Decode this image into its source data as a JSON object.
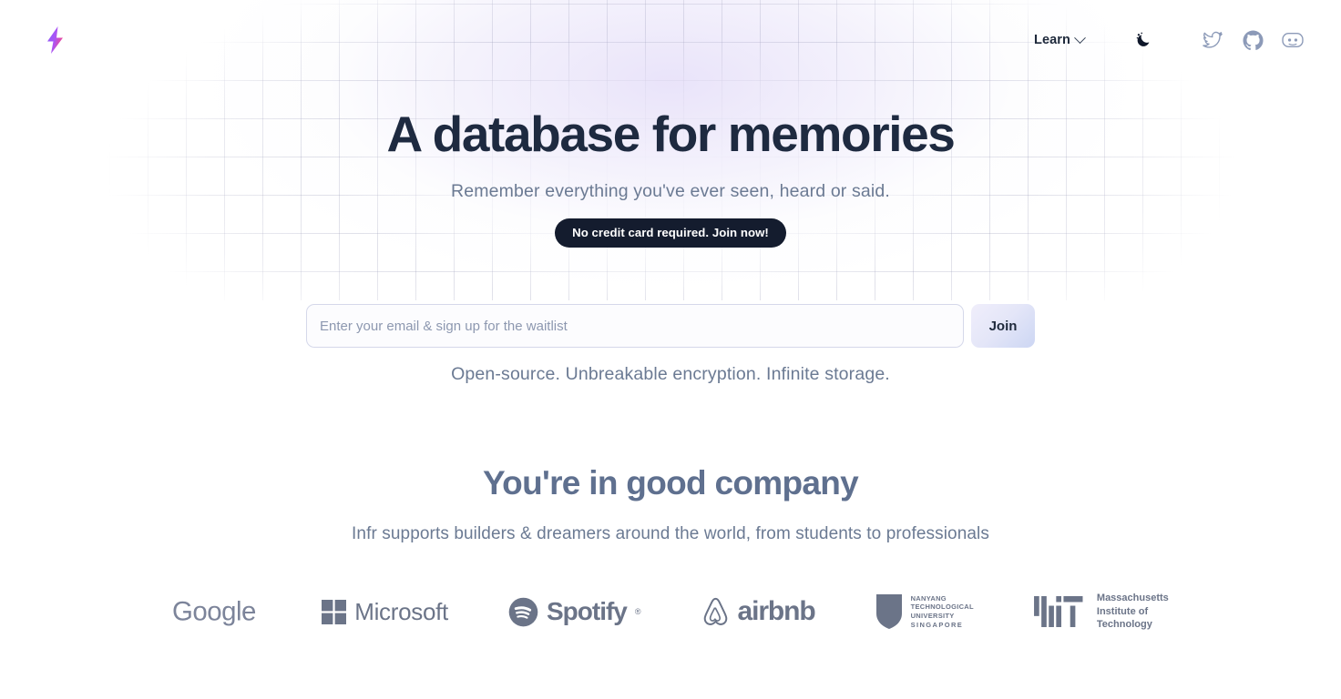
{
  "brand": {
    "logo_icon": "lightning-bolt-icon",
    "logo_gradient_from": "#7c3aed",
    "logo_gradient_to": "#e8379f"
  },
  "nav": {
    "learn_label": "Learn",
    "learn_chevron_icon": "chevron-down-icon",
    "theme_toggle_icon": "moon-stars-icon",
    "socials": [
      {
        "name": "twitter-icon",
        "label": "Twitter"
      },
      {
        "name": "github-icon",
        "label": "GitHub"
      },
      {
        "name": "discord-icon",
        "label": "Discord"
      }
    ]
  },
  "hero": {
    "headline": "A database for memories",
    "subhead": "Remember everything you've ever seen, heard or said.",
    "badge": "No credit card required. Join now!"
  },
  "signup": {
    "placeholder": "Enter your email & sign up for the waitlist",
    "value": "",
    "join_label": "Join"
  },
  "tagline": "Open-source. Unbreakable encryption. Infinite storage.",
  "company": {
    "title": "You're in good company",
    "subtitle": "Infr supports builders & dreamers around the world, from students to professionals",
    "logos": [
      {
        "name": "google-logo",
        "label": "Google"
      },
      {
        "name": "microsoft-logo",
        "label": "Microsoft"
      },
      {
        "name": "spotify-logo",
        "label": "Spotify"
      },
      {
        "name": "airbnb-logo",
        "label": "airbnb"
      },
      {
        "name": "ntu-logo",
        "line1": "NANYANG",
        "line2": "TECHNOLOGICAL",
        "line3": "UNIVERSITY",
        "line4": "SINGAPORE"
      },
      {
        "name": "mit-logo",
        "line1": "Massachusetts",
        "line2": "Institute of",
        "line3": "Technology"
      }
    ]
  },
  "colors": {
    "text_dark": "#1e2a40",
    "text_muted": "#6b7a93",
    "logo_gray": "#6b7488",
    "badge_bg": "#141c2e",
    "accent_lavender": "#e8e2f9"
  }
}
